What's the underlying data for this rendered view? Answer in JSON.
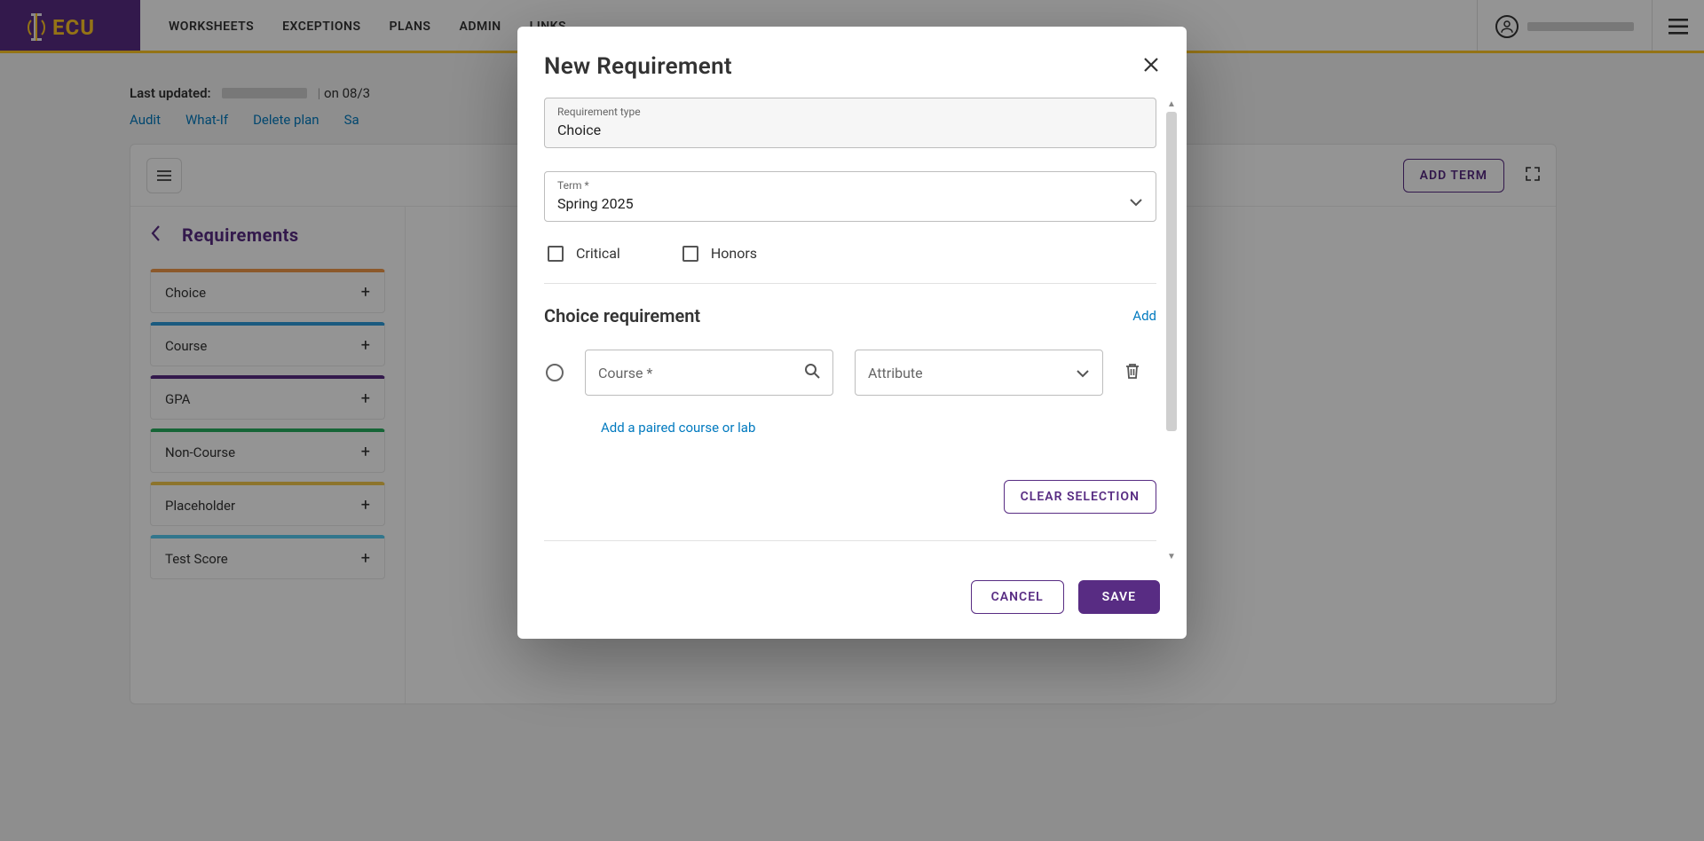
{
  "nav": {
    "items": [
      "WORKSHEETS",
      "EXCEPTIONS",
      "PLANS",
      "ADMIN",
      "LINKS"
    ]
  },
  "meta": {
    "last_updated_label": "Last updated:",
    "on_label": "on",
    "date_partial": "08/3"
  },
  "actions": {
    "audit": "Audit",
    "what_if": "What-If",
    "delete": "Delete plan",
    "save_partial": "Sa"
  },
  "planner": {
    "add_term": "ADD TERM",
    "sidebar_title": "Requirements",
    "items": [
      {
        "label": "Choice"
      },
      {
        "label": "Course"
      },
      {
        "label": "GPA"
      },
      {
        "label": "Non-Course"
      },
      {
        "label": "Placeholder"
      },
      {
        "label": "Test Score"
      }
    ]
  },
  "modal": {
    "title": "New Requirement",
    "req_type_label": "Requirement type",
    "req_type_value": "Choice",
    "term_label": "Term *",
    "term_value": "Spring 2025",
    "checkbox_critical": "Critical",
    "checkbox_honors": "Honors",
    "section_title": "Choice requirement",
    "section_add": "Add",
    "course_placeholder": "Course *",
    "attribute_placeholder": "Attribute",
    "paired_link": "Add a paired course or lab",
    "clear_btn": "CLEAR SELECTION",
    "cancel": "CANCEL",
    "save": "SAVE"
  }
}
